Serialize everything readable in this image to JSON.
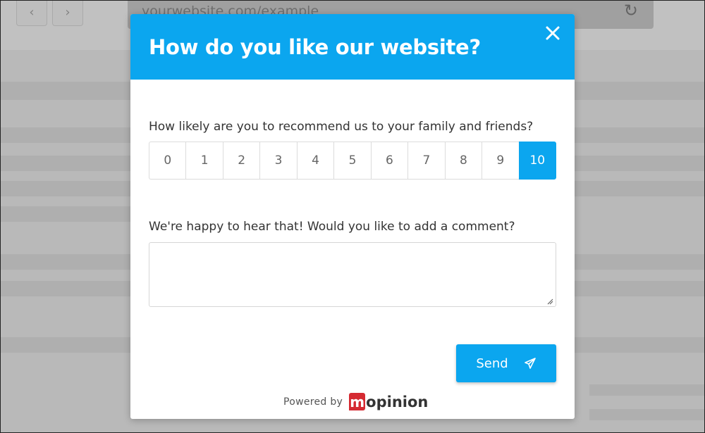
{
  "browser": {
    "url": "yourwebsite.com/example",
    "back_icon": "chevron-left-icon",
    "forward_icon": "chevron-right-icon",
    "reload_icon": "reload-icon"
  },
  "survey": {
    "title": "How do you like our website?",
    "close_icon": "close-icon",
    "question_1": "How likely are you to recommend us to your family and friends?",
    "scale": [
      "0",
      "1",
      "2",
      "3",
      "4",
      "5",
      "6",
      "7",
      "8",
      "9",
      "10"
    ],
    "selected": "10",
    "question_2": "We're happy to hear that! Would you like to add a comment?",
    "comment_value": "",
    "send_label": "Send",
    "send_icon": "paper-plane-icon",
    "powered_by": "Powered by",
    "brand": "mopinion",
    "brand_mark": "m",
    "brand_rest": "opinion"
  },
  "colors": {
    "accent": "#0ba6ef",
    "brand_red": "#d52a32"
  }
}
